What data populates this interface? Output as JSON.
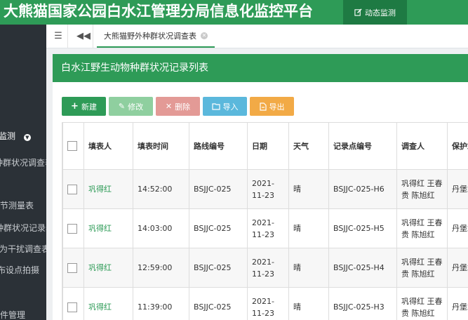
{
  "header": {
    "title": "大熊猫国家公园白水江管理分局信息化监控平台",
    "active_tab": "动态监测"
  },
  "sidebar": {
    "items": [
      {
        "label": "监测"
      },
      {
        "label": "种群状况调查表"
      },
      {
        "label": "物候节测量表"
      },
      {
        "label": "种群状况记录表"
      },
      {
        "label": "人为干扰调查表"
      },
      {
        "label": "红外相机布设点拍摄"
      },
      {
        "label": "文件管理"
      }
    ]
  },
  "tabbar": {
    "page_tab": "大熊猫野外种群状况调查表"
  },
  "panel": {
    "title": "白水江野生动物种群状况记录列表"
  },
  "toolbar": {
    "new": "新建",
    "edit": "修改",
    "delete": "删除",
    "import": "导入",
    "export": "导出",
    "colors": {
      "new": "#2e9b57",
      "edit": "#8fcf9f",
      "delete": "#e39a96",
      "import": "#5bb8dc",
      "export": "#f2aa46"
    }
  },
  "table": {
    "headers": [
      "填表人",
      "填表时间",
      "路线编号",
      "日期",
      "天气",
      "记录点编号",
      "调查人",
      "保护站"
    ],
    "rows": [
      {
        "filler": "巩得红",
        "time": "14:52:00",
        "route": "BSJJC-025",
        "date": "2021-11-23",
        "weather": "晴",
        "point": "BSJJC-025-H6",
        "surveyor": "巩得红 王春贵 陈旭红",
        "station": "丹堡站"
      },
      {
        "filler": "巩得红",
        "time": "14:03:00",
        "route": "BSJJC-025",
        "date": "2021-11-23",
        "weather": "晴",
        "point": "BSJJC-025-H5",
        "surveyor": "巩得红 王春贵 陈旭红",
        "station": "丹堡站"
      },
      {
        "filler": "巩得红",
        "time": "12:59:00",
        "route": "BSJJC-025",
        "date": "2021-11-23",
        "weather": "晴",
        "point": "BSJJC-025-H4",
        "surveyor": "巩得红 王春贵 陈旭红",
        "station": "丹堡站"
      },
      {
        "filler": "巩得红",
        "time": "11:39:00",
        "route": "BSJJC-025",
        "date": "2021-11-23",
        "weather": "晴",
        "point": "BSJJC-025-H3",
        "surveyor": "巩得红 王春贵 陈旭红",
        "station": "丹堡站"
      }
    ]
  }
}
